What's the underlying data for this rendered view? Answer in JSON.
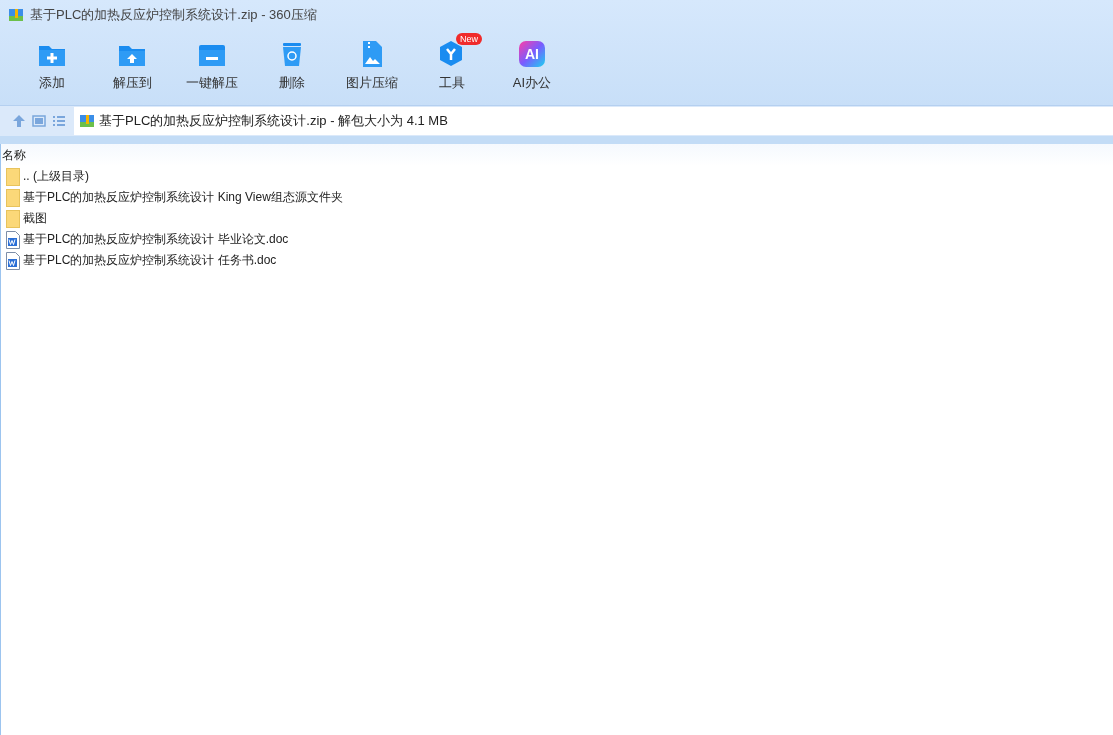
{
  "window": {
    "title": "基于PLC的加热反应炉控制系统设计.zip - 360压缩"
  },
  "toolbar": [
    {
      "kind": "add",
      "label": "添加"
    },
    {
      "kind": "extract-to",
      "label": "解压到"
    },
    {
      "kind": "extract",
      "label": "一键解压"
    },
    {
      "kind": "delete",
      "label": "删除"
    },
    {
      "kind": "image",
      "label": "图片压缩"
    },
    {
      "kind": "tools",
      "label": "工具",
      "badge": "New"
    },
    {
      "kind": "ai",
      "label": "AI办公",
      "icon_text": "AI"
    }
  ],
  "address_bar": {
    "path": "基于PLC的加热反应炉控制系统设计.zip - 解包大小为 4.1 MB"
  },
  "table": {
    "columns": [
      "名称"
    ],
    "rows": [
      {
        "kind": "folder",
        "name": ".. (上级目录)"
      },
      {
        "kind": "folder",
        "name": "基于PLC的加热反应炉控制系统设计 King View组态源文件夹"
      },
      {
        "kind": "folder",
        "name": "截图"
      },
      {
        "kind": "doc",
        "name": "基于PLC的加热反应炉控制系统设计 毕业论文.doc"
      },
      {
        "kind": "doc",
        "name": "基于PLC的加热反应炉控制系统设计 任务书.doc"
      }
    ]
  }
}
